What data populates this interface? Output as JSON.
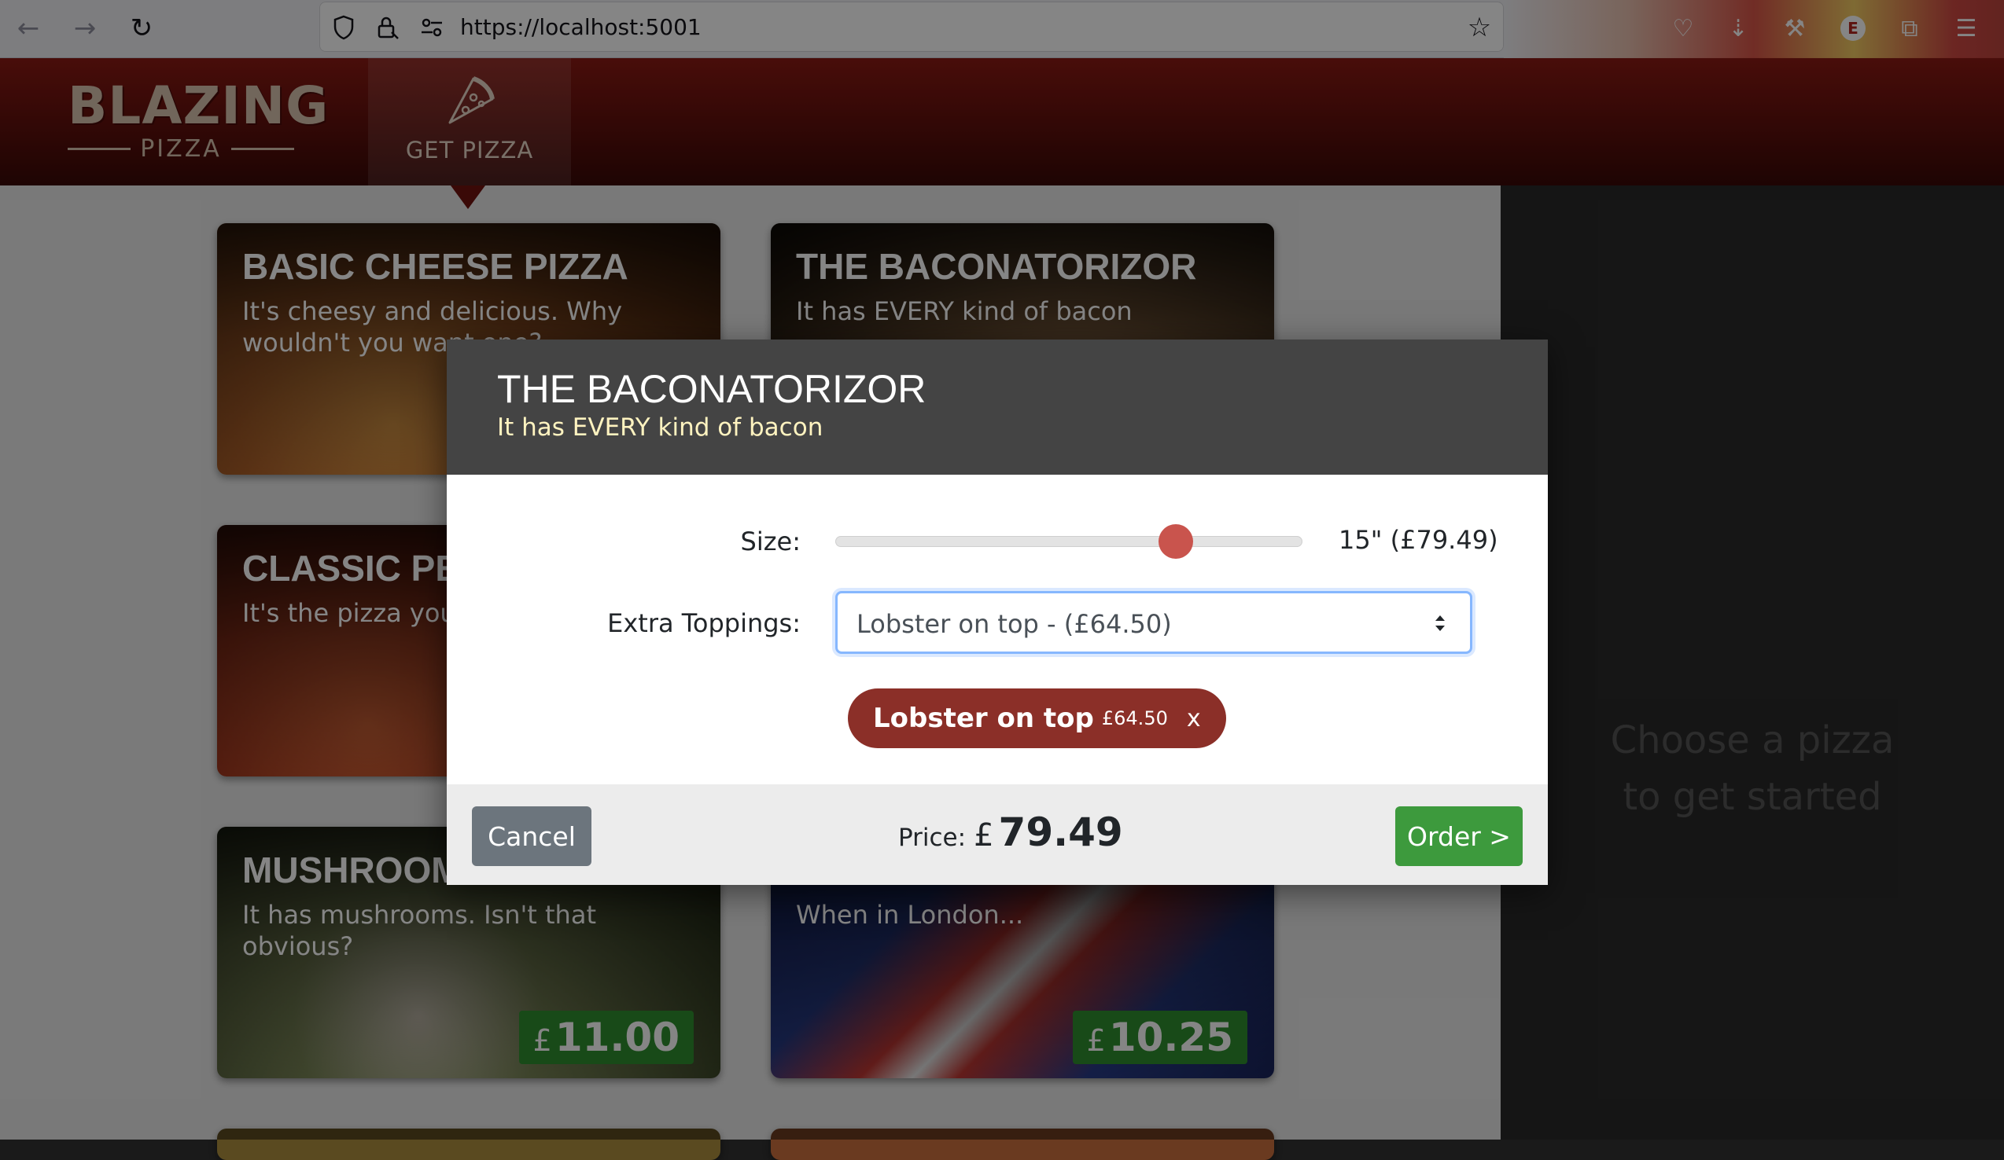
{
  "browser": {
    "url": "https://localhost:5001",
    "profile_initial": "E"
  },
  "header": {
    "logo_main": "BLAZING",
    "logo_sub": "PIZZA",
    "nav_get_pizza": "GET PIZZA"
  },
  "cards": [
    {
      "title": "BASIC CHEESE PIZZA",
      "description": "It's cheesy and delicious. Why wouldn't you want one?",
      "bg": "#b5642b"
    },
    {
      "title": "THE BACONATORIZOR",
      "description": "It has EVERY kind of bacon",
      "bg": "#7a5a3a"
    },
    {
      "title": "CLASSIC PE",
      "description": "It's the pizza you g Blazing hot!",
      "bg": "#a8391f"
    },
    {
      "title": "MUSHROOM",
      "description": "It has mushrooms. Isn't that obvious?",
      "price_currency": "£",
      "price": "11.00",
      "bg": "#4a5a30"
    },
    {
      "title": "",
      "description": "When in London...",
      "price_currency": "£",
      "price": "10.25",
      "bg": "#2a3f8f"
    }
  ],
  "sidebar": {
    "empty_line1": "Choose a pizza",
    "empty_line2": "to get started"
  },
  "dialog": {
    "title": "THE BACONATORIZOR",
    "subtitle": "It has EVERY kind of bacon",
    "size_label": "Size:",
    "size_value": "15\" (£79.49)",
    "size_slider_fraction": 0.73,
    "toppings_label": "Extra Toppings:",
    "toppings_selected": "Lobster on top - (£64.50)",
    "topping_chips": [
      {
        "name": "Lobster on top",
        "price": "£64.50",
        "remove": "x"
      }
    ],
    "cancel_label": "Cancel",
    "price_label": "Price:",
    "price_currency": "£",
    "price_value": "79.49",
    "order_label": "Order >"
  },
  "colors": {
    "header_red": "#6b1410",
    "chip_red": "#8b2f28",
    "order_green": "#3d9a3d",
    "price_green": "#2f8f2f",
    "cancel_grey": "#6c757d"
  }
}
